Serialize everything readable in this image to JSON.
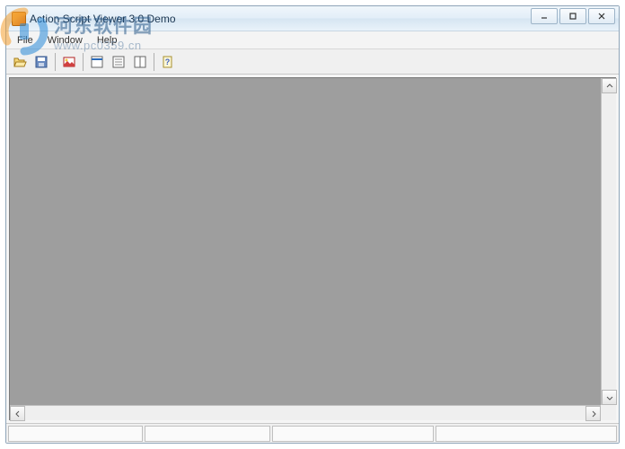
{
  "window": {
    "title": "Action Script Viewer 3.0 Demo"
  },
  "menubar": {
    "items": [
      "File",
      "Window",
      "Help"
    ]
  },
  "toolbar": {
    "icons": [
      "open-icon",
      "save-icon",
      "image-icon",
      "view-icon",
      "list-icon",
      "panel-icon",
      "help-icon"
    ]
  },
  "watermark": {
    "text_cn": "河东软件园",
    "url": "www.pc0359.cn"
  }
}
